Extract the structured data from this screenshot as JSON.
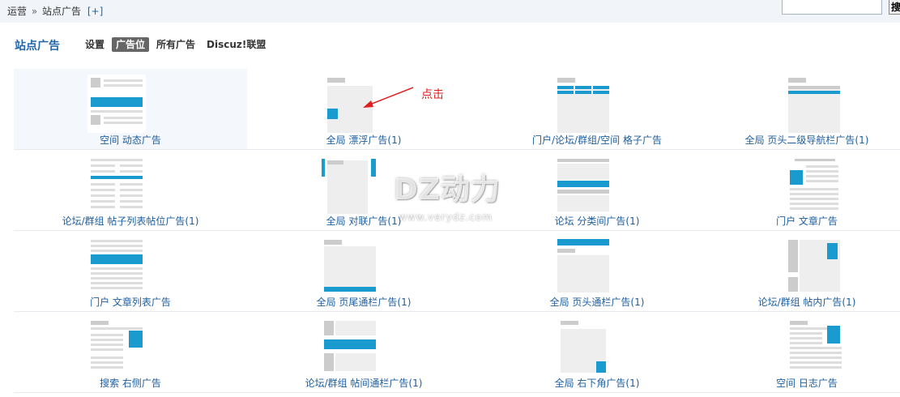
{
  "breadcrumb": {
    "root": "运营",
    "separator": "»",
    "current": "站点广告",
    "add": "[+]"
  },
  "search": {
    "value": "",
    "button_label": "搜"
  },
  "page_title": "站点广告",
  "tabs": [
    {
      "label": "设置",
      "active": false
    },
    {
      "label": "广告位",
      "active": true
    },
    {
      "label": "所有广告",
      "active": false
    },
    {
      "label": "Discuz!联盟",
      "active": false
    }
  ],
  "ad_positions": [
    {
      "label": "空间 动态广告",
      "icon": "feed-ad-thumb"
    },
    {
      "label": "全局 漂浮广告(1)",
      "icon": "float-ad-thumb"
    },
    {
      "label": "门户/论坛/群组/空间 格子广告",
      "icon": "grid-ad-thumb"
    },
    {
      "label": "全局 页头二级导航栏广告(1)",
      "icon": "subnav-ad-thumb"
    },
    {
      "label": "论坛/群组 帖子列表帖位广告(1)",
      "icon": "threadlist-ad-thumb"
    },
    {
      "label": "全局 对联广告(1)",
      "icon": "couplet-ad-thumb"
    },
    {
      "label": "论坛 分类间广告(1)",
      "icon": "intercat-ad-thumb"
    },
    {
      "label": "门户 文章广告",
      "icon": "article-ad-thumb"
    },
    {
      "label": "门户 文章列表广告",
      "icon": "articlelist-ad-thumb"
    },
    {
      "label": "全局 页尾通栏广告(1)",
      "icon": "footer-banner-ad-thumb"
    },
    {
      "label": "全局 页头通栏广告(1)",
      "icon": "header-banner-ad-thumb"
    },
    {
      "label": "论坛/群组 帖内广告(1)",
      "icon": "thread-inner-ad-thumb"
    },
    {
      "label": "搜索 右侧广告",
      "icon": "search-right-ad-thumb"
    },
    {
      "label": "论坛/群组 帖间通栏广告(1)",
      "icon": "interthread-ad-thumb"
    },
    {
      "label": "全局 右下角广告(1)",
      "icon": "corner-ad-thumb"
    },
    {
      "label": "空间 日志广告",
      "icon": "blog-ad-thumb"
    }
  ],
  "annotation": {
    "text": "点击"
  },
  "watermark": {
    "brand": "DZ动力",
    "url": "www.verydz.com"
  },
  "colors": {
    "accent": "#1a9bd0",
    "placeholder": "#cccccc",
    "link": "#1e5fa0",
    "annotation": "#e02020"
  }
}
